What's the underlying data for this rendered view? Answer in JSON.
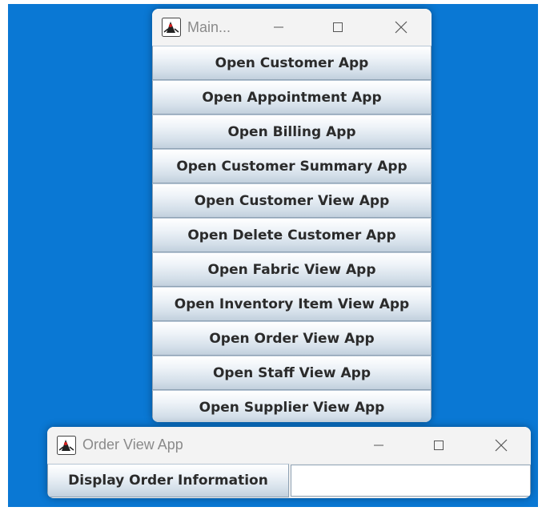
{
  "main_window": {
    "title": "Main...",
    "buttons": [
      "Open Customer App",
      "Open Appointment App",
      "Open Billing App",
      "Open Customer Summary App",
      "Open Customer View App",
      "Open Delete Customer App",
      "Open Fabric View App",
      "Open Inventory Item View App",
      "Open Order View App",
      "Open Staff View App",
      "Open Supplier View App"
    ]
  },
  "order_window": {
    "title": "Order View App",
    "button_label": "Display Order Information",
    "field_value": ""
  },
  "colors": {
    "desktop": "#0a78d4",
    "titlebar": "#f3f3f3"
  },
  "icons": {
    "app": "java-duke-icon",
    "minimize": "minimize-icon",
    "maximize": "maximize-icon",
    "close": "close-icon"
  }
}
